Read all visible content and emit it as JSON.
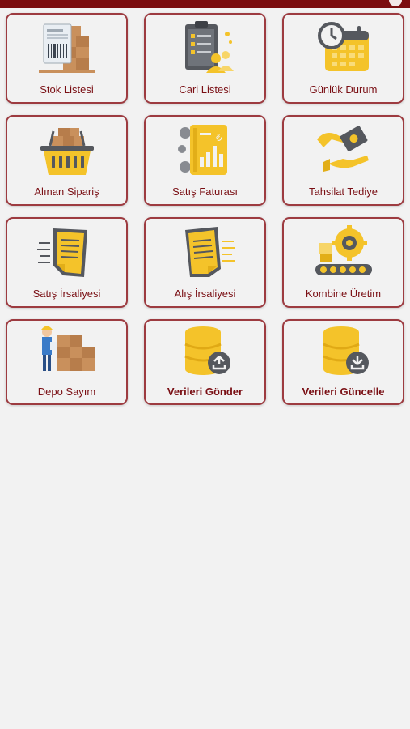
{
  "menu": {
    "items": [
      {
        "label": "Stok Listesi",
        "icon": "warehouse-stock-icon"
      },
      {
        "label": "Cari Listesi",
        "icon": "customer-clipboard-icon"
      },
      {
        "label": "Günlük Durum",
        "icon": "calendar-clock-icon"
      },
      {
        "label": "Alınan Sipariş",
        "icon": "shopping-basket-icon"
      },
      {
        "label": "Satış Faturası",
        "icon": "invoice-chart-icon"
      },
      {
        "label": "Tahsilat Tediye",
        "icon": "hand-payment-icon"
      },
      {
        "label": "Satış İrsaliyesi",
        "icon": "dispatch-document-icon"
      },
      {
        "label": "Alış İrsaliyesi",
        "icon": "purchase-document-icon"
      },
      {
        "label": "Kombine Üretim",
        "icon": "production-gear-icon"
      },
      {
        "label": "Depo Sayım",
        "icon": "warehouse-worker-icon"
      },
      {
        "label": "Verileri Gönder",
        "icon": "database-upload-icon"
      },
      {
        "label": "Verileri Güncelle",
        "icon": "database-download-icon"
      }
    ]
  },
  "colors": {
    "header": "#7b0d0f",
    "tile_border": "#9d3b40",
    "label": "#7a0f14",
    "icon_yellow": "#f4c32a",
    "icon_dark": "#55585e"
  }
}
